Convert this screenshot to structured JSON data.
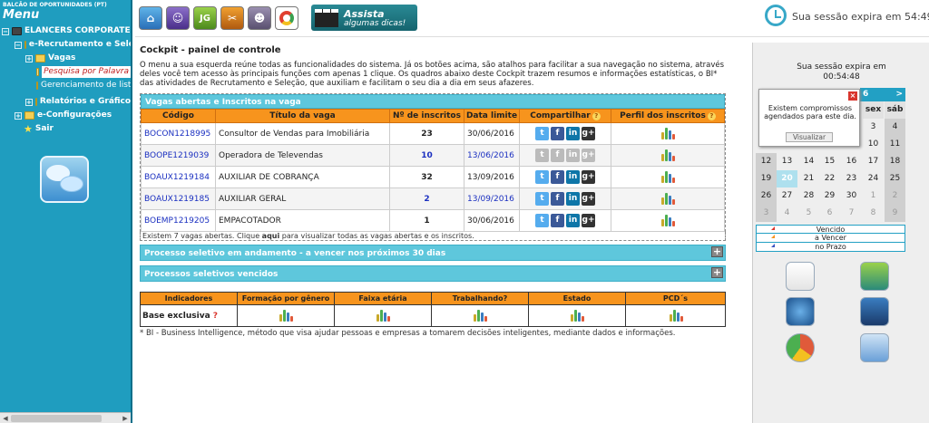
{
  "sidebar": {
    "company": "BALCÃO DE OPORTUNIDADES (PT)",
    "menu_title": "Menu",
    "tree": {
      "root": "ELANCERS CORPORATE",
      "recruitment": "e-Recrutamento e Sele",
      "vagas": "Vagas",
      "search": "Pesquisa por Palavra",
      "list_manager": "Gerenciamento de list",
      "reports": "Relatórios e Gráfico",
      "config": "e-Configurações",
      "exit": "Sair"
    }
  },
  "toolbar": {
    "assista_line1": "Assista",
    "assista_line2": "algumas dicas!",
    "session": "Sua sessão expira em 54:49."
  },
  "main": {
    "title": "Cockpit - painel de controle",
    "intro": "O menu a sua esquerda reúne todas as funcionalidades do sistema. Já os botões acima, são atalhos para facilitar a sua navegação no sistema, através deles você tem acesso às principais funções com apenas 1 clique. Os quadros abaixo deste Cockpit trazem resumos e informações estatísticas, o BI* das atividades de Recrutamento e Seleção, que auxiliam e facilitam o seu dia a dia em seus afazeres.",
    "jobs_panel_title": "Vagas abertas e Inscritos na vaga",
    "jobs_columns": [
      "Código",
      "Título da vaga",
      "Nº de inscritos",
      "Data limite",
      "Compartilhar",
      "Perfil dos inscritos"
    ],
    "jobs": [
      {
        "code": "BOCON1218995",
        "title": "Consultor de Vendas para Imobiliária",
        "count": "23",
        "date": "30/06/2016"
      },
      {
        "code": "BOOPE1219039",
        "title": "Operadora de Televendas",
        "count": "10",
        "date": "13/06/2016"
      },
      {
        "code": "BOAUX1219184",
        "title": "AUXILIAR DE COBRANÇA",
        "count": "32",
        "date": "13/09/2016"
      },
      {
        "code": "BOAUX1219185",
        "title": "AUXILIAR GERAL",
        "count": "2",
        "date": "13/09/2016"
      },
      {
        "code": "BOEMP1219205",
        "title": "EMPACOTADOR",
        "count": "1",
        "date": "30/06/2016"
      }
    ],
    "jobs_footer_pre": "Existem 7 vagas abertas. Clique ",
    "jobs_footer_link": "aqui",
    "jobs_footer_post": " para visualizar todas as vagas abertas e os inscritos.",
    "process_due_title": "Processo seletivo em andamento - a vencer nos próximos 30 dias",
    "process_expired_title": "Processos seletivos vencidos",
    "indicators_columns": [
      "Indicadores",
      "Formação por gênero",
      "Faixa etária",
      "Trabalhando?",
      "Estado",
      "PCD´s"
    ],
    "indicators_row_label": "Base exclusiva",
    "footnote": "* BI - Business Intelligence, método que visa ajudar pessoas e empresas a tomarem decisões inteligentes, mediante dados e informações."
  },
  "rightpanel": {
    "session_line1": "Sua sessão expira em",
    "session_line2": "00:54:48",
    "cal_month_suffix": "6",
    "cal_next": ">",
    "dow": [
      "sex",
      "sáb"
    ],
    "week1": [
      "3",
      "4"
    ],
    "week2": [
      "10",
      "11"
    ],
    "week3": [
      "12",
      "13",
      "14",
      "15",
      "16",
      "17",
      "18"
    ],
    "week4": [
      "19",
      "20",
      "21",
      "22",
      "23",
      "24",
      "25"
    ],
    "week5": [
      "26",
      "27",
      "28",
      "29",
      "30",
      "1",
      "2"
    ],
    "week6": [
      "3",
      "4",
      "5",
      "6",
      "7",
      "8",
      "9"
    ],
    "popup_msg": "Existem compromissos agendados para este dia.",
    "popup_button": "Visualizar",
    "legend": [
      "Vencido",
      "a Vencer",
      "no Prazo"
    ],
    "legend_colors": [
      "#d9352d",
      "#f7941d",
      "#3a55c0"
    ]
  }
}
